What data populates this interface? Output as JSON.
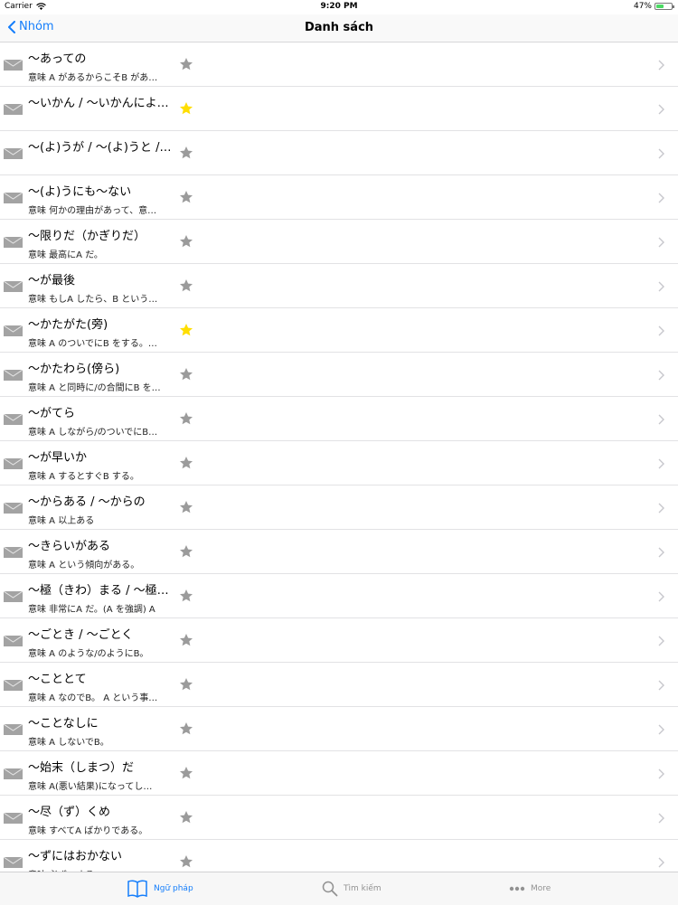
{
  "status_bar": {
    "carrier": "Carrier",
    "time": "9:20 PM",
    "battery": "47%"
  },
  "nav": {
    "back_label": "Nhóm",
    "title": "Danh sách"
  },
  "colors": {
    "accent": "#157efb",
    "star_active": "#ffde00",
    "star_inactive": "#9b9b9b",
    "battery_fill": "#4cd964"
  },
  "items": [
    {
      "title": "～あっての",
      "subtitle": "意味 A があるからこそB があ…",
      "starred": false
    },
    {
      "title": "～いかん / ～いかんによ…",
      "subtitle": "",
      "starred": true
    },
    {
      "title": "～(よ)うが / ～(よ)うと /…",
      "subtitle": "",
      "starred": false
    },
    {
      "title": "～(よ)うにも～ない",
      "subtitle": "意味 何かの理由があって、意…",
      "starred": false
    },
    {
      "title": "～限りだ（かぎりだ）",
      "subtitle": "意味 最高にA だ。",
      "starred": false
    },
    {
      "title": "～が最後",
      "subtitle": "意味 もしA したら、B という…",
      "starred": false
    },
    {
      "title": "～かたがた(旁)",
      "subtitle": "意味 A のついでにB をする。…",
      "starred": true
    },
    {
      "title": "～かたわら(傍ら)",
      "subtitle": "意味 A と同時に/の合間にB を…",
      "starred": false
    },
    {
      "title": "～がてら",
      "subtitle": "意味 A しながら/のついでにB…",
      "starred": false
    },
    {
      "title": "～が早いか",
      "subtitle": "意味 A するとすぐB する。",
      "starred": false
    },
    {
      "title": "～からある / ～からの",
      "subtitle": "意味 A 以上ある",
      "starred": false
    },
    {
      "title": "～きらいがある",
      "subtitle": "意味 A という傾向がある。",
      "starred": false
    },
    {
      "title": "～極（きわ）まる / ～極…",
      "subtitle": "意味 非常にA だ。(A を強調) A",
      "starred": false
    },
    {
      "title": "～ごとき / ～ごとく",
      "subtitle": "意味 A のような/のようにB。",
      "starred": false
    },
    {
      "title": "～こととて",
      "subtitle": "意味 A なのでB。 A という事…",
      "starred": false
    },
    {
      "title": "～ことなしに",
      "subtitle": "意味 A しないでB。",
      "starred": false
    },
    {
      "title": "～始末（しまつ）だ",
      "subtitle": "意味 A(悪い結果)になってし…",
      "starred": false
    },
    {
      "title": "～尽（ず）くめ",
      "subtitle": "意味 すべてA ばかりである。",
      "starred": false
    },
    {
      "title": "～ずにはおかない",
      "subtitle": "意味 必ずA する",
      "starred": false
    }
  ],
  "tabs": [
    {
      "label": "Ngữ pháp",
      "icon": "book-icon",
      "active": true
    },
    {
      "label": "Tìm kiếm",
      "icon": "search-icon",
      "active": false
    },
    {
      "label": "More",
      "icon": "more-icon",
      "active": false
    }
  ]
}
